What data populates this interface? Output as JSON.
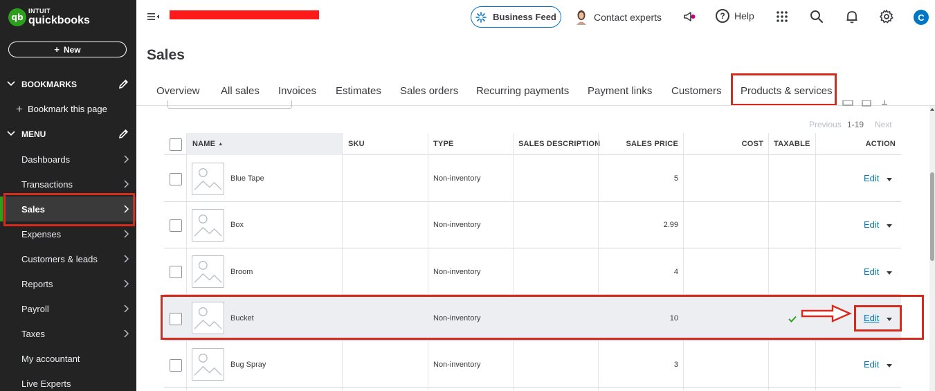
{
  "brand": {
    "top": "INTUIT",
    "bottom": "quickbooks",
    "mark": "qb"
  },
  "sidebar": {
    "new_label": "New",
    "bookmarks_label": "BOOKMARKS",
    "bookmark_page_label": "Bookmark this page",
    "menu_label": "MENU",
    "items": [
      {
        "label": "Dashboards"
      },
      {
        "label": "Transactions"
      },
      {
        "label": "Sales"
      },
      {
        "label": "Expenses"
      },
      {
        "label": "Customers & leads"
      },
      {
        "label": "Reports"
      },
      {
        "label": "Payroll"
      },
      {
        "label": "Taxes"
      },
      {
        "label": "My accountant"
      },
      {
        "label": "Live Experts"
      }
    ]
  },
  "header": {
    "business_feed": "Business Feed",
    "contact_experts": "Contact experts",
    "help": "Help",
    "user_initial": "C"
  },
  "page": {
    "title": "Sales",
    "tabs": [
      {
        "label": "Overview"
      },
      {
        "label": "All sales"
      },
      {
        "label": "Invoices"
      },
      {
        "label": "Estimates"
      },
      {
        "label": "Sales orders"
      },
      {
        "label": "Recurring payments"
      },
      {
        "label": "Payment links"
      },
      {
        "label": "Customers"
      },
      {
        "label": "Products & services"
      }
    ]
  },
  "pager": {
    "previous": "Previous",
    "range": "1-19",
    "next": "Next"
  },
  "table": {
    "columns": {
      "name": "NAME",
      "sort": "▲",
      "sku": "SKU",
      "type": "TYPE",
      "sales_description": "SALES DESCRIPTION",
      "sales_price": "SALES PRICE",
      "cost": "COST",
      "taxable": "TAXABLE",
      "action": "ACTION"
    },
    "rows": [
      {
        "name": "Blue Tape",
        "sku": "",
        "type": "Non-inventory",
        "description": "",
        "price": "5",
        "cost": "",
        "taxable": false,
        "action": "Edit"
      },
      {
        "name": "Box",
        "sku": "",
        "type": "Non-inventory",
        "description": "",
        "price": "2.99",
        "cost": "",
        "taxable": false,
        "action": "Edit"
      },
      {
        "name": "Broom",
        "sku": "",
        "type": "Non-inventory",
        "description": "",
        "price": "4",
        "cost": "",
        "taxable": false,
        "action": "Edit"
      },
      {
        "name": "Bucket",
        "sku": "",
        "type": "Non-inventory",
        "description": "",
        "price": "10",
        "cost": "",
        "taxable": true,
        "action": "Edit"
      },
      {
        "name": "Bug Spray",
        "sku": "",
        "type": "Non-inventory",
        "description": "",
        "price": "3",
        "cost": "",
        "taxable": false,
        "action": "Edit"
      }
    ]
  },
  "colors": {
    "sidebar_bg": "#232323",
    "brand_green": "#2ca01c",
    "link_blue": "#0077c5",
    "annotation_red": "#d52b1e"
  }
}
